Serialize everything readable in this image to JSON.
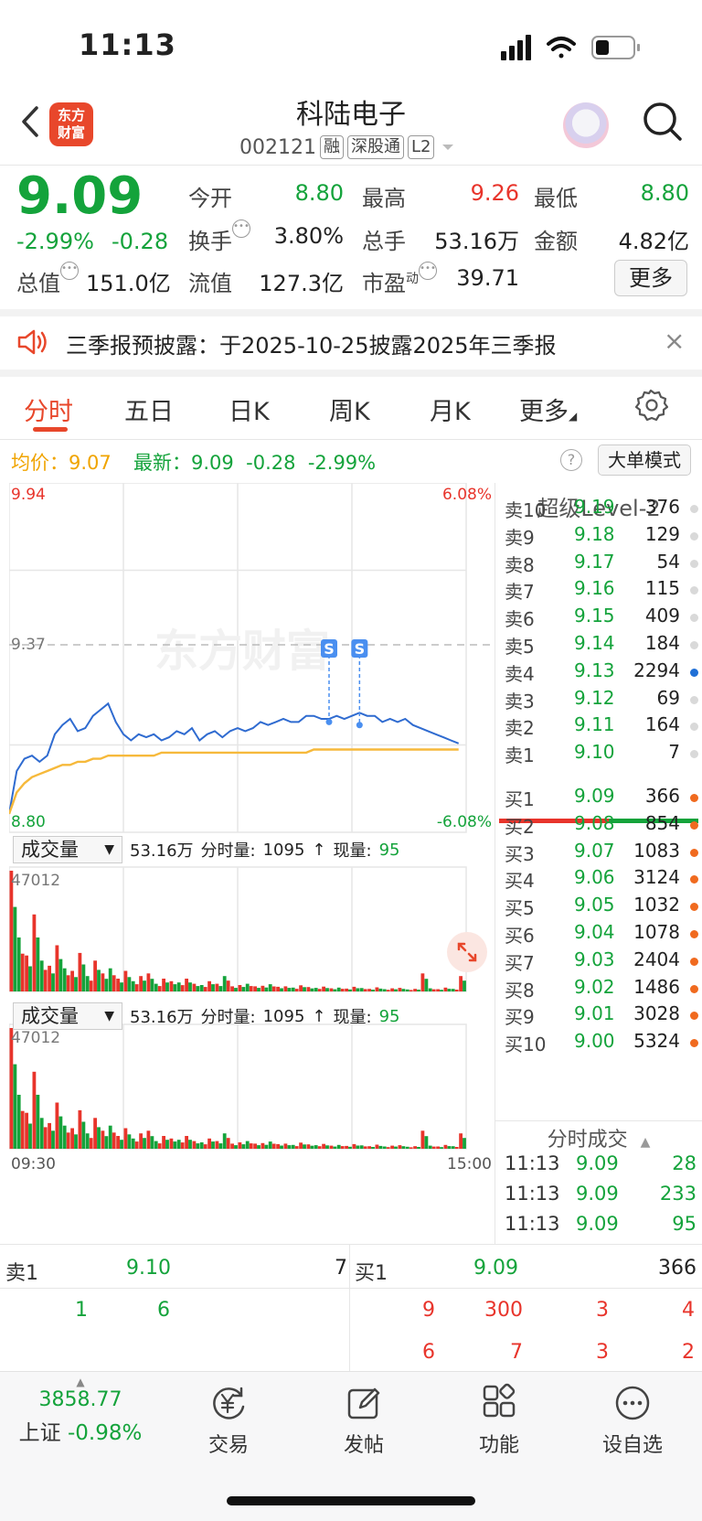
{
  "status": {
    "time": "11:13"
  },
  "header": {
    "logo_line1": "东方",
    "logo_line2": "财富",
    "stock_name": "科陆电子",
    "code": "002121",
    "tags": [
      "融",
      "深股通",
      "L2"
    ]
  },
  "quote": {
    "last_price": "9.09",
    "change_pct": "-2.99%",
    "change_abs": "-0.28",
    "total_value_label": "总值",
    "total_value": "151.0亿",
    "rows": [
      [
        {
          "label": "今开",
          "value": "8.80"
        },
        {
          "label": "最高",
          "value": "9.26"
        },
        {
          "label": "最低",
          "value": "8.80"
        }
      ],
      [
        {
          "label": "换手",
          "value": "3.80%"
        },
        {
          "label": "总手",
          "value": "53.16万"
        },
        {
          "label": "金额",
          "value": "4.82亿"
        }
      ],
      [
        {
          "label": "流值",
          "value": "127.3亿"
        },
        {
          "label": "市盈",
          "sup": "动",
          "value": "39.71"
        }
      ]
    ],
    "more_label": "更多"
  },
  "announcement": {
    "text": "三季报预披露：于2025-10-25披露2025年三季报",
    "close": "×"
  },
  "tabs": [
    "分时",
    "五日",
    "日K",
    "周K",
    "月K",
    "更多"
  ],
  "info_line": {
    "avg_label": "均价：",
    "avg_value": "9.07",
    "latest_label": "最新：",
    "latest_value": "9.09",
    "latest_change": "-0.28",
    "latest_pct": "-2.99%",
    "help": "?",
    "big_order_label": "大单模式"
  },
  "chart": {
    "watermark": "东方财富",
    "y_max": "9.94",
    "y_mid": "9.37",
    "y_min": "8.80",
    "pct_max": "6.08%",
    "pct_min": "-6.08%",
    "signal": "S",
    "time_start": "09:30",
    "time_end": "15:00",
    "volume_panels": [
      {
        "select": "成交量",
        "total": "53.16万",
        "minute_label": "分时量:",
        "minute_value": "1095",
        "arrow": "↑",
        "now_label": "现量:",
        "now_value": "95",
        "max": "47012"
      },
      {
        "select": "成交量",
        "total": "53.16万",
        "minute_label": "分时量:",
        "minute_value": "1095",
        "arrow": "↑",
        "now_label": "现量:",
        "now_value": "95",
        "max": "47012"
      }
    ]
  },
  "chart_data": {
    "type": "line",
    "series": [
      {
        "name": "最新",
        "values": [
          8.86,
          9.0,
          9.04,
          9.05,
          9.03,
          9.05,
          9.12,
          9.15,
          9.17,
          9.13,
          9.14,
          9.18,
          9.2,
          9.22,
          9.16,
          9.12,
          9.1,
          9.12,
          9.11,
          9.12,
          9.1,
          9.11,
          9.13,
          9.12,
          9.14,
          9.1,
          9.12,
          9.13,
          9.11,
          9.13,
          9.14,
          9.13,
          9.14,
          9.16,
          9.15,
          9.16,
          9.17,
          9.16,
          9.16,
          9.18,
          9.18,
          9.17,
          9.17,
          9.18,
          9.17,
          9.18,
          9.19,
          9.18,
          9.18,
          9.16,
          9.17,
          9.16,
          9.17,
          9.15,
          9.14,
          9.13,
          9.12,
          9.11,
          9.1,
          9.09
        ]
      },
      {
        "name": "均价",
        "values": [
          8.86,
          8.93,
          8.96,
          8.98,
          8.99,
          9.0,
          9.01,
          9.02,
          9.02,
          9.03,
          9.03,
          9.04,
          9.04,
          9.05,
          9.05,
          9.05,
          9.05,
          9.05,
          9.05,
          9.05,
          9.06,
          9.06,
          9.06,
          9.06,
          9.06,
          9.06,
          9.06,
          9.06,
          9.06,
          9.06,
          9.06,
          9.06,
          9.06,
          9.06,
          9.06,
          9.06,
          9.06,
          9.06,
          9.06,
          9.06,
          9.07,
          9.07,
          9.07,
          9.07,
          9.07,
          9.07,
          9.07,
          9.07,
          9.07,
          9.07,
          9.07,
          9.07,
          9.07,
          9.07,
          9.07,
          9.07,
          9.07,
          9.07,
          9.07,
          9.07
        ]
      }
    ],
    "ylim": [
      8.8,
      9.94
    ],
    "total_minutes": 240,
    "grid": true,
    "volume": [
      47012,
      21000,
      14000,
      30000,
      12000,
      10000,
      18000,
      9000,
      8000,
      15000,
      6000,
      12000,
      7000,
      9000,
      5000,
      8000,
      4000,
      6000,
      7000,
      3000,
      5000,
      4000,
      3500,
      5000,
      3000,
      2500,
      4000,
      3000,
      6000,
      2000,
      2500,
      3000,
      2000,
      2200,
      2800,
      1800,
      2000,
      1500,
      2400,
      1700,
      1400,
      1900,
      1200,
      1500,
      1100,
      1800,
      1300,
      1000,
      1600,
      900,
      1200,
      1400,
      800,
      1000,
      7000,
      1200,
      900,
      1500,
      1000,
      6000
    ]
  },
  "order_book": {
    "title": "超级Level-2",
    "asks": [
      {
        "label": "卖10",
        "price": "9.19",
        "vol": "376"
      },
      {
        "label": "卖9",
        "price": "9.18",
        "vol": "129"
      },
      {
        "label": "卖8",
        "price": "9.17",
        "vol": "54"
      },
      {
        "label": "卖7",
        "price": "9.16",
        "vol": "115"
      },
      {
        "label": "卖6",
        "price": "9.15",
        "vol": "409"
      },
      {
        "label": "卖5",
        "price": "9.14",
        "vol": "184"
      },
      {
        "label": "卖4",
        "price": "9.13",
        "vol": "2294"
      },
      {
        "label": "卖3",
        "price": "9.12",
        "vol": "69"
      },
      {
        "label": "卖2",
        "price": "9.11",
        "vol": "164"
      },
      {
        "label": "卖1",
        "price": "9.10",
        "vol": "7"
      }
    ],
    "bids": [
      {
        "label": "买1",
        "price": "9.09",
        "vol": "366"
      },
      {
        "label": "买2",
        "price": "9.08",
        "vol": "854"
      },
      {
        "label": "买3",
        "price": "9.07",
        "vol": "1083"
      },
      {
        "label": "买4",
        "price": "9.06",
        "vol": "3124"
      },
      {
        "label": "买5",
        "price": "9.05",
        "vol": "1032"
      },
      {
        "label": "买6",
        "price": "9.04",
        "vol": "1078"
      },
      {
        "label": "买7",
        "price": "9.03",
        "vol": "2404"
      },
      {
        "label": "买8",
        "price": "9.02",
        "vol": "1486"
      },
      {
        "label": "买9",
        "price": "9.01",
        "vol": "3028"
      },
      {
        "label": "买10",
        "price": "9.00",
        "vol": "5324"
      }
    ],
    "ticks_title": "分时成交",
    "ticks": [
      {
        "time": "11:13",
        "price": "9.09",
        "vol": "28"
      },
      {
        "time": "11:13",
        "price": "9.09",
        "vol": "233"
      },
      {
        "time": "11:13",
        "price": "9.09",
        "vol": "95"
      }
    ]
  },
  "level1": {
    "sell_label": "卖1",
    "sell_price": "9.10",
    "sell_vol": "7",
    "buy_label": "买1",
    "buy_price": "9.09",
    "buy_vol": "366",
    "sell_queue": [
      "1",
      "6"
    ],
    "buy_queue_row1": [
      "9",
      "300",
      "3",
      "4"
    ],
    "buy_queue_row2": [
      "6",
      "7",
      "3",
      "2"
    ]
  },
  "bottom_nav": {
    "index_value": "3858.77",
    "index_name": "上证",
    "index_change": "-0.98%",
    "items": [
      "交易",
      "发帖",
      "功能",
      "设自选"
    ]
  }
}
